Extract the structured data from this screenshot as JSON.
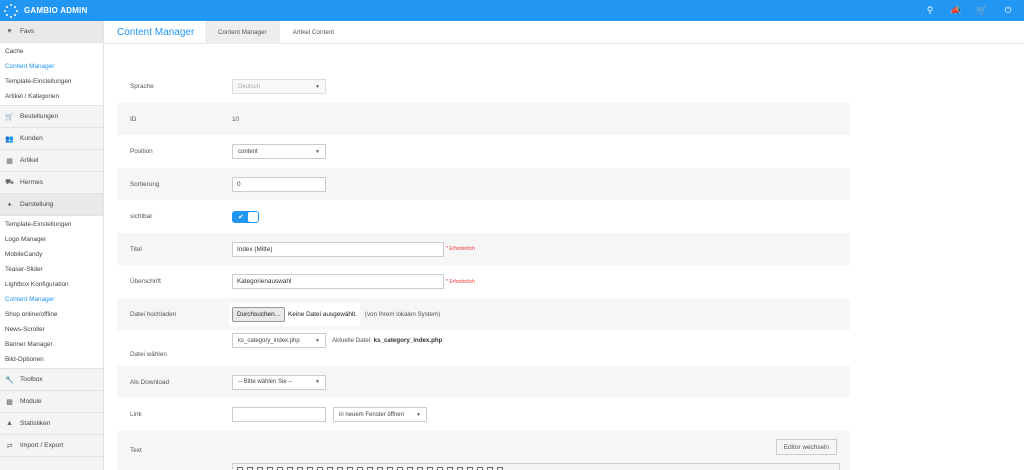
{
  "app": {
    "brand": "GAMBIO ADMIN"
  },
  "topbar_icons": [
    "search-icon",
    "megaphone-icon",
    "cart-icon",
    "power-icon"
  ],
  "colors": {
    "accent": "#2196f3",
    "required": "#e53935"
  },
  "sidebar": {
    "favs_label": "Favs",
    "favs_items": [
      "Cache",
      "Content Manager",
      "Template-Einstellungen",
      "Artikel / Kategorien"
    ],
    "sections": {
      "bestellungen": "Bestellungen",
      "kunden": "Kunden",
      "artikel": "Artikel",
      "hermes": "Hermes",
      "darstellung": "Darstellung",
      "toolbox": "Toolbox",
      "module": "Module",
      "statistiken": "Statistiken",
      "import_export": "Import / Export"
    },
    "darstellung_items": [
      "Template-Einstellungen",
      "Logo Manager",
      "MobileCandy",
      "Teaser-Slider",
      "Lightbox Konfiguration",
      "Content Manager",
      "Shop online/offline",
      "News-Scroller",
      "Banner Manager",
      "Bild-Optionen"
    ]
  },
  "header": {
    "title": "Content Manager",
    "tabs": [
      "Content Manager",
      "Artikel Content"
    ]
  },
  "form": {
    "sprache": {
      "label": "Sprache",
      "value": "Deutsch"
    },
    "id": {
      "label": "ID",
      "value": "10"
    },
    "position": {
      "label": "Position",
      "value": "content"
    },
    "sortierung": {
      "label": "Sortierung",
      "value": "0"
    },
    "sichtbar": {
      "label": "sichtbar",
      "checked": true
    },
    "titel": {
      "label": "Titel",
      "value": "Index (Mitte)",
      "required": "* Erforderlich"
    },
    "ueberschrift": {
      "label": "Überschrift",
      "value": "Kategorienauswahl",
      "required": "* Erforderlich"
    },
    "datei_hochladen": {
      "label": "Datei hochladen",
      "button": "Durchsuchen...",
      "no_file": "Keine Datei ausgewählt.",
      "hint": "(von Ihrem lokalen System)"
    },
    "datei_waehlen": {
      "label": "Datei wählen",
      "value": "ks_category_index.php",
      "current_prefix": "Aktuelle Datei:",
      "current_file": "ks_category_index.php"
    },
    "als_download": {
      "label": "Als Download",
      "value": "-- Bitte wählen Sie --"
    },
    "link": {
      "label": "Link",
      "value": "",
      "target": "in neuem Fenster öffnen"
    },
    "text": {
      "label": "Text",
      "editor_button": "Editor wechseln"
    }
  }
}
